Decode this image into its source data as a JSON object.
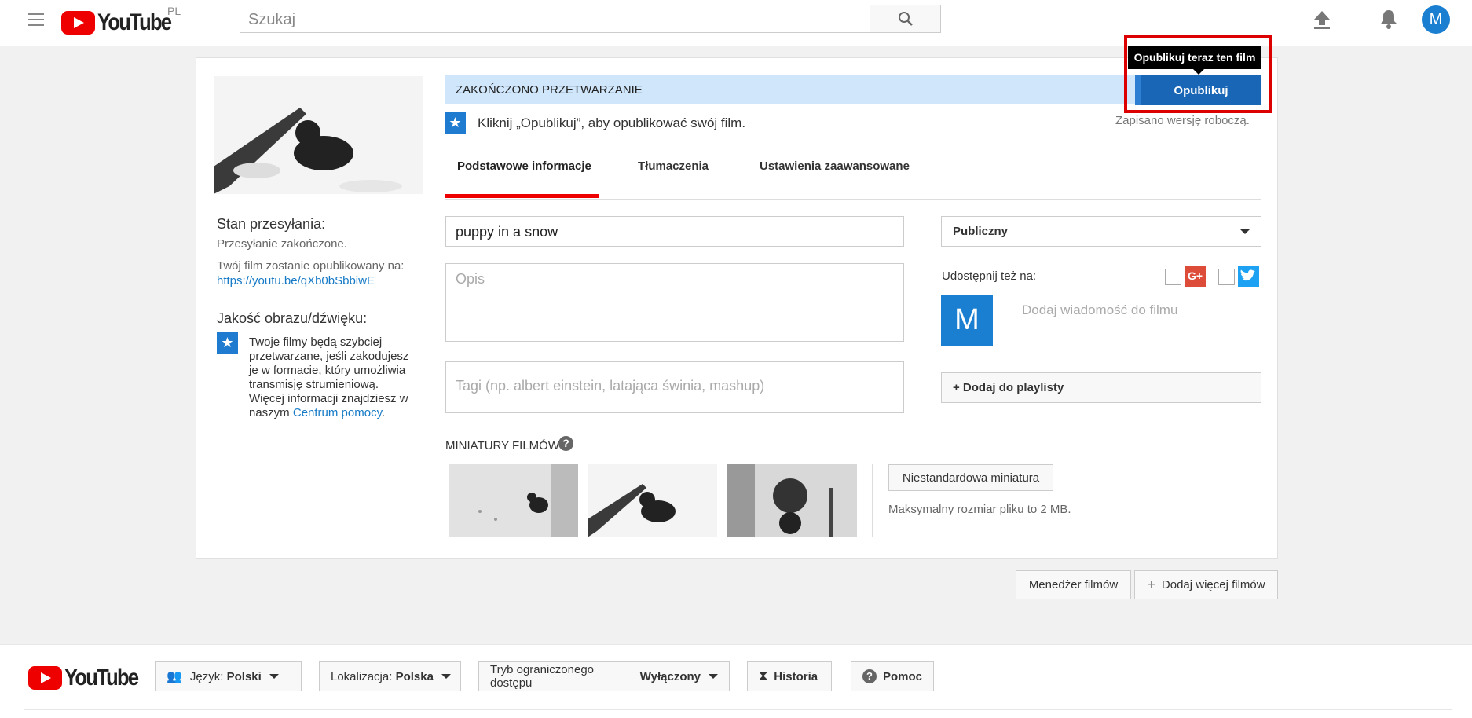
{
  "header": {
    "logo_text": "YouTube",
    "region": "PL",
    "search_placeholder": "Szukaj",
    "avatar_letter": "M"
  },
  "status": {
    "banner": "ZAKOŃCZONO PRZETWARZANIE",
    "publish_label": "Opublikuj",
    "tooltip": "Opublikuj teraz ten film",
    "instruction": "Kliknij „Opublikuj”, aby opublikować swój film.",
    "draft_saved": "Zapisano wersję roboczą."
  },
  "left_panel": {
    "upload_status_title": "Stan przesyłania:",
    "upload_status_value": "Przesyłanie zakończone.",
    "publish_on_label": "Twój film zostanie opublikowany na:",
    "video_url": "https://youtu.be/qXb0bSbbiwE",
    "quality_title": "Jakość obrazu/dźwięku:",
    "quality_text": "Twoje filmy będą szybciej przetwarzane, jeśli zakodujesz je w formacie, który umożliwia transmisję strumieniową. Więcej informacji znajdziesz w naszym",
    "help_link": "Centrum pomocy",
    "help_suffix": "."
  },
  "tabs": [
    {
      "label": "Podstawowe informacje",
      "active": true
    },
    {
      "label": "Tłumaczenia",
      "active": false
    },
    {
      "label": "Ustawienia zaawansowane",
      "active": false
    }
  ],
  "form": {
    "title_value": "puppy in a snow",
    "description_placeholder": "Opis",
    "tags_placeholder": "Tagi (np. albert einstein, latająca świnia, mashup)",
    "privacy_value": "Publiczny",
    "share_label": "Udostępnij też na:",
    "share_avatar": "M",
    "message_placeholder": "Dodaj wiadomość do filmu",
    "playlist_label": "+ Dodaj do playlisty",
    "thumbnails_title": "MINIATURY FILMÓW",
    "custom_thumb_label": "Niestandardowa miniatura",
    "max_size": "Maksymalny rozmiar pliku to 2 MB.",
    "gplus_glyph": "G+"
  },
  "bottom_buttons": {
    "manager": "Menedżer filmów",
    "add_more": "Dodaj więcej filmów"
  },
  "footer": {
    "logo_text": "YouTube",
    "language_label": "Język:",
    "language_value": "Polski",
    "location_label": "Lokalizacja:",
    "location_value": "Polska",
    "restricted_label": "Tryb ograniczonego dostępu",
    "restricted_value": "Wyłączony",
    "history": "Historia",
    "help": "Pomoc"
  },
  "colors": {
    "accent_blue": "#1866b5",
    "banner_blue": "#cfe6fb",
    "youtube_red": "#e00000",
    "highlight_red": "#dd0000"
  }
}
